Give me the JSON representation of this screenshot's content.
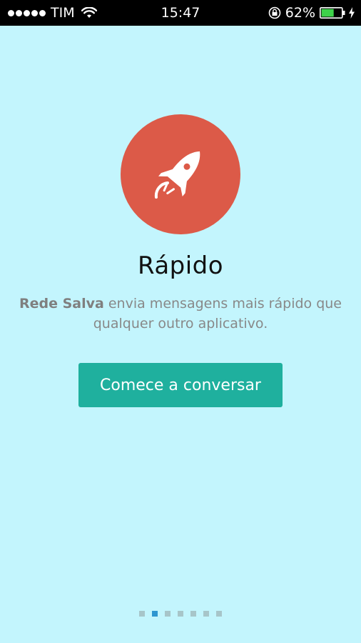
{
  "status_bar": {
    "carrier": "TIM",
    "time": "15:47",
    "battery_percent": "62%",
    "battery_level": 0.62
  },
  "onboarding": {
    "icon": "rocket-icon",
    "icon_bg_color": "#dc5a48",
    "title": "Rápido",
    "description_bold": "Rede Salva",
    "description_rest": " envia mensagens mais rápido que qualquer outro aplicativo.",
    "cta_label": "Comece a conversar",
    "cta_color": "#1fb09e",
    "background_color": "#c3f5fd"
  },
  "pager": {
    "total": 7,
    "active_index": 1,
    "active_color": "#2e96d0"
  }
}
